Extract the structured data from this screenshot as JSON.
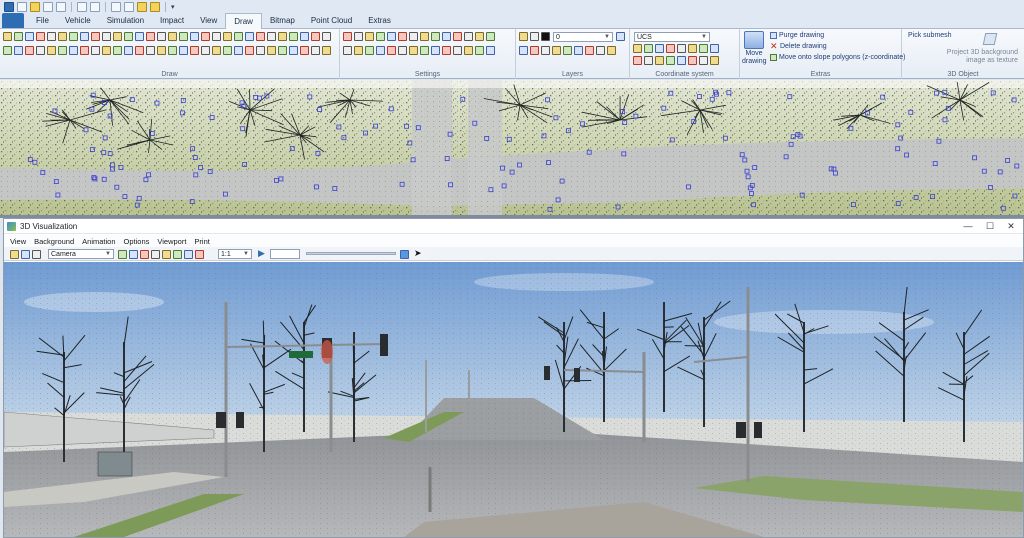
{
  "ribbon_tabs": [
    {
      "label": "File",
      "active": false
    },
    {
      "label": "Vehicle",
      "active": false
    },
    {
      "label": "Simulation",
      "active": false
    },
    {
      "label": "Impact",
      "active": false
    },
    {
      "label": "View",
      "active": false
    },
    {
      "label": "Draw",
      "active": true
    },
    {
      "label": "Bitmap",
      "active": false
    },
    {
      "label": "Point Cloud",
      "active": false
    },
    {
      "label": "Extras",
      "active": false
    }
  ],
  "groups": {
    "draw": "Draw",
    "settings": "Settings",
    "layers": "Layers",
    "coordinate_system": "Coordinate system",
    "extras": "Extras",
    "object_3d": "3D Object"
  },
  "layers": {
    "current_layer": "0"
  },
  "coordinate_system": {
    "ucs_value": "UCS"
  },
  "extras": {
    "move_drawing": "Move drawing",
    "purge_drawing": "Purge drawing",
    "delete_drawing": "Delete drawing",
    "move_onto_slope": "Move onto slope polygons (z-coordinate)"
  },
  "object_3d": {
    "pick_submesh": "Pick submesh",
    "project_background": "Project 3D background image as texture"
  },
  "viz_window": {
    "title": "3D Visualization",
    "minimize": "—",
    "maximize": "☐",
    "close": "✕",
    "menu": [
      "View",
      "Background",
      "Animation",
      "Options",
      "Viewport",
      "Print"
    ],
    "camera_select": "Camera",
    "scale_select": "1:1"
  },
  "icons": {
    "pointer": "arrow-pointer",
    "play": "play-triangle",
    "camera": "camera",
    "layer": "lightbulb"
  },
  "colors": {
    "ribbon_accent": "#2f6db3",
    "marker_blue": "#3a3fd0",
    "sky_top": "#6f9bd3",
    "sky_bottom": "#e9eef3"
  }
}
